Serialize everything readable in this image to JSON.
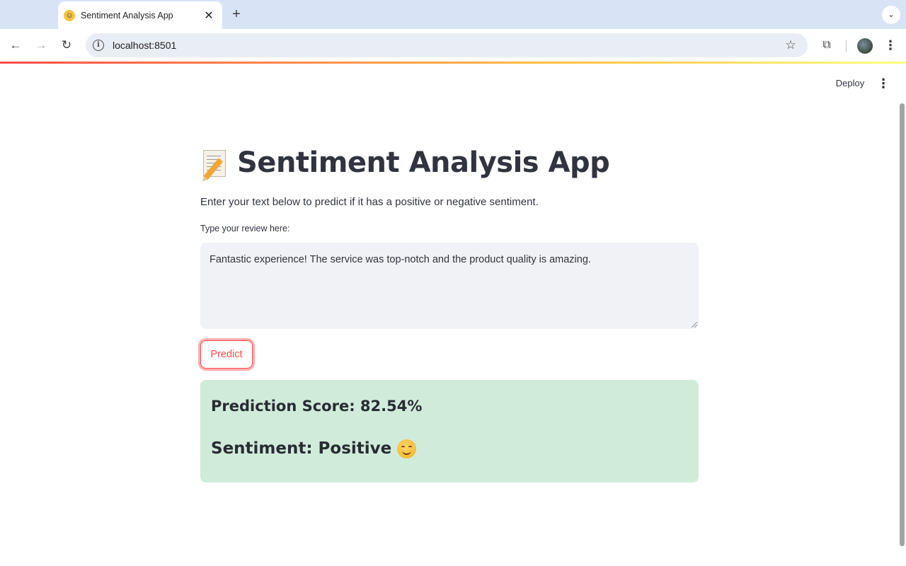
{
  "browser": {
    "tab_title": "Sentiment Analysis App",
    "url": "localhost:8501",
    "new_tab_symbol": "+",
    "close_symbol": "✕"
  },
  "app": {
    "deploy_label": "Deploy",
    "title": "Sentiment Analysis App",
    "subtitle": "Enter your text below to predict if it has a positive or negative sentiment.",
    "review_label": "Type your review here:",
    "review_value": "Fantastic experience! The service was top-notch and the product quality is amazing.",
    "predict_label": "Predict",
    "prediction_score_text": "Prediction Score: 82.54%",
    "sentiment_text": "Sentiment: Positive",
    "prediction_score_value": 82.54
  },
  "colors": {
    "accent": "#ff4b4b",
    "success_bg": "#d1ebdb",
    "input_bg": "#f0f2f6",
    "text": "#31333f"
  },
  "icons": {
    "title_icon": "memo-icon",
    "sentiment_icon": "smiling-face-icon"
  }
}
